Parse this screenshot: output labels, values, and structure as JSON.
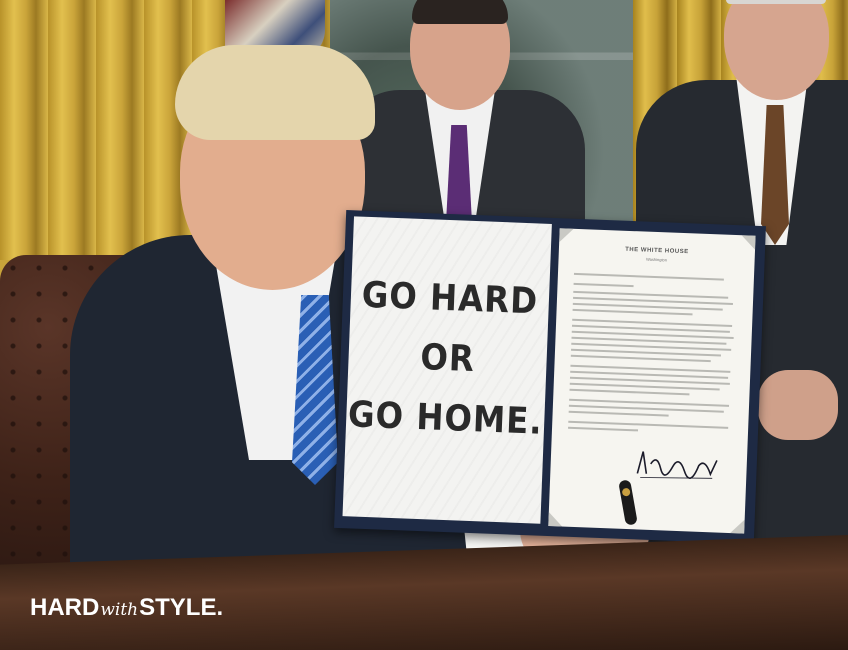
{
  "photo": {
    "description_objects": [
      "curtains",
      "window",
      "leather-chair",
      "three-men",
      "signed-order-folder",
      "desk"
    ],
    "colors": {
      "curtain": "#d4af3f",
      "main_suit": "#1f2632",
      "main_tie": "#2a5fb5",
      "folder": "#1e2a44",
      "desk": "#4a2d1e"
    }
  },
  "document": {
    "slogan_lines": [
      "GO HARD",
      "OR",
      "GO HOME."
    ],
    "letterhead": "THE WHITE HOUSE",
    "letterhead_sub": "Washington"
  },
  "logo": {
    "part1": "HARD",
    "part2": "with",
    "part3": "STYLE."
  }
}
